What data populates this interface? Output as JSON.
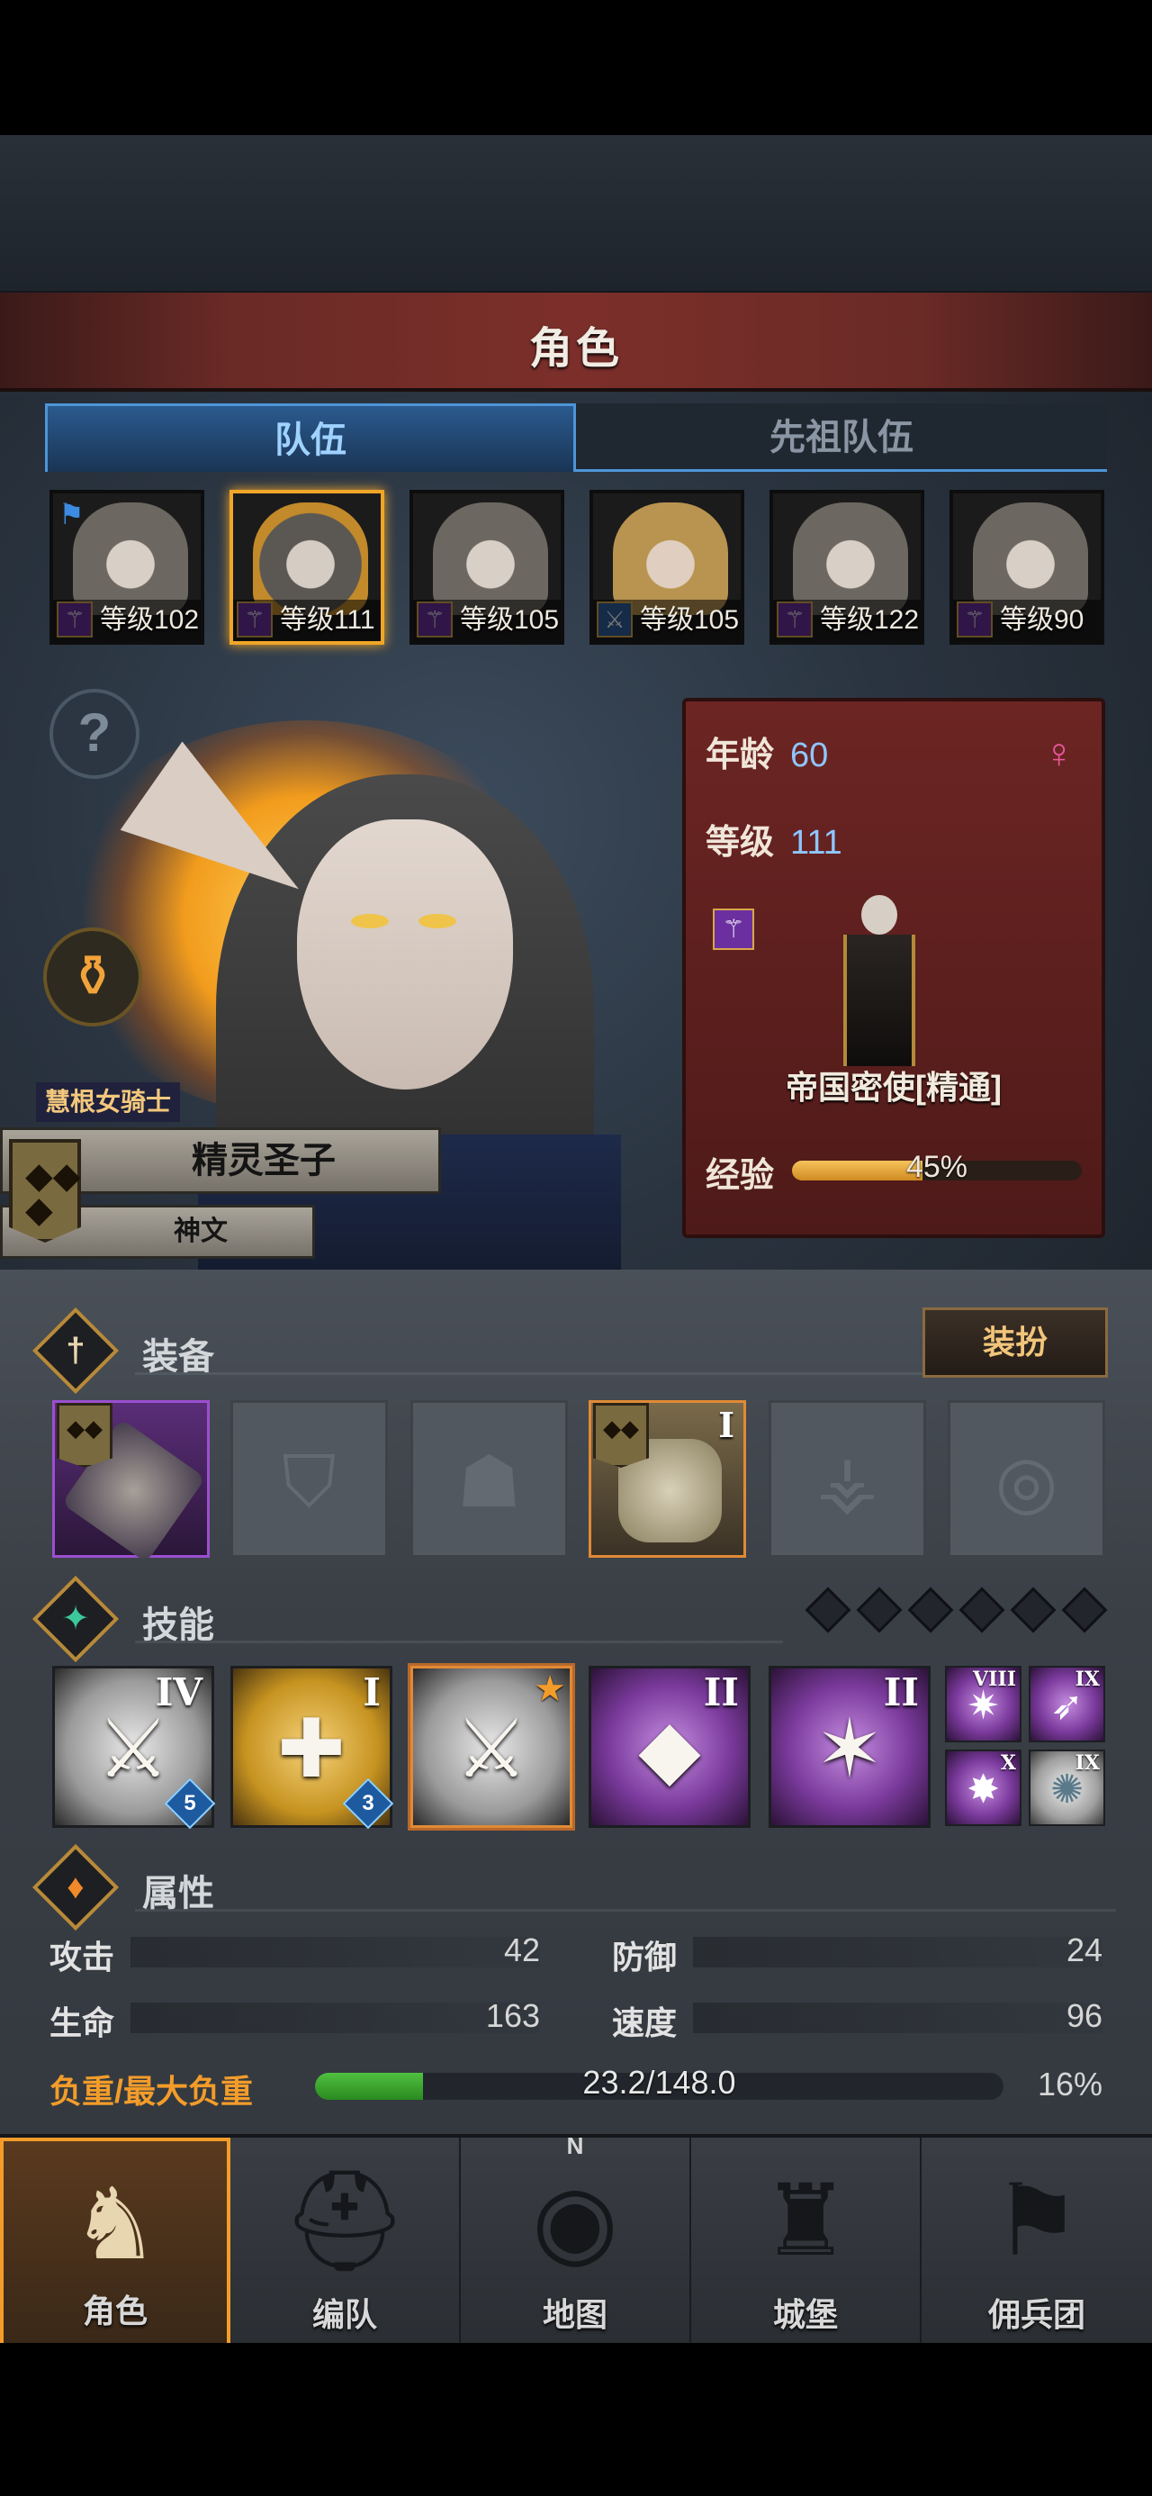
{
  "header": {
    "title": "角色"
  },
  "tabs": [
    {
      "label": "队伍"
    },
    {
      "label": "先祖队伍"
    }
  ],
  "roster": [
    {
      "level_text": "等级102",
      "flag": "⚑"
    },
    {
      "level_text": "等级111"
    },
    {
      "level_text": "等级105"
    },
    {
      "level_text": "等级105"
    },
    {
      "level_text": "等级122"
    },
    {
      "level_text": "等级90"
    }
  ],
  "character": {
    "subtitle": "慧根女骑士",
    "name": "精灵圣子",
    "sub_name": "神文",
    "age_label": "年龄",
    "age_value": "60",
    "level_label": "等级",
    "level_value": "111",
    "class_title": "帝国密使[精通]",
    "exp_label": "经验",
    "exp_text": "45%",
    "exp_fraction": 0.45
  },
  "sections": {
    "equipment": "装备",
    "skills": "技能",
    "attributes": "属性",
    "dress_button": "装扮"
  },
  "equipment_tier": "I",
  "skills": [
    {
      "roman": "IV",
      "gem": "5"
    },
    {
      "roman": "I",
      "gem": "3"
    },
    {
      "roman": ""
    },
    {
      "roman": "II"
    },
    {
      "roman": "II"
    }
  ],
  "mini_skills": [
    {
      "roman": "VIII"
    },
    {
      "roman": "IX"
    },
    {
      "roman": "X"
    },
    {
      "roman": "IX"
    }
  ],
  "stats": {
    "attack_label": "攻击",
    "attack_value": "42",
    "defense_label": "防御",
    "defense_value": "24",
    "hp_label": "生命",
    "hp_value": "163",
    "speed_label": "速度",
    "speed_value": "96",
    "load_label": "负重/最大负重",
    "load_text": "23.2/148.0",
    "load_percent": "16%",
    "load_fraction": 0.157
  },
  "nav": [
    {
      "label": "角色"
    },
    {
      "label": "编队"
    },
    {
      "label": "地图"
    },
    {
      "label": "城堡"
    },
    {
      "label": "佣兵团"
    }
  ],
  "compass_n": "N"
}
